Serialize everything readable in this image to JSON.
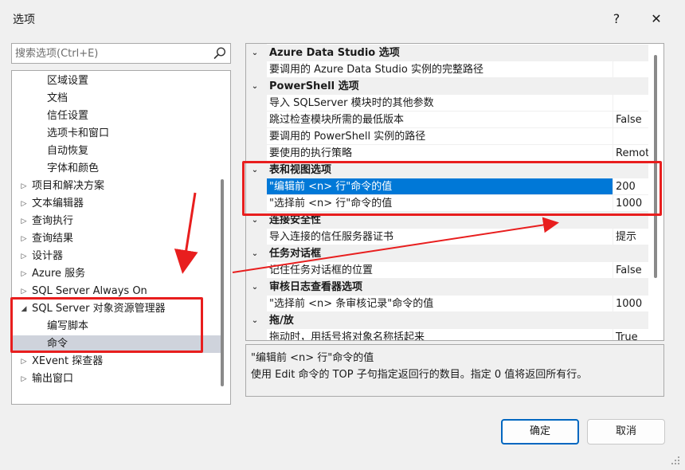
{
  "window": {
    "title": "选项",
    "help_glyph": "?",
    "close_glyph": "✕"
  },
  "search": {
    "placeholder": "搜索选项(Ctrl+E)"
  },
  "tree": [
    {
      "label": "区域设置",
      "level": 2
    },
    {
      "label": "文档",
      "level": 2
    },
    {
      "label": "信任设置",
      "level": 2
    },
    {
      "label": "选项卡和窗口",
      "level": 2
    },
    {
      "label": "自动恢复",
      "level": 2
    },
    {
      "label": "字体和颜色",
      "level": 2
    },
    {
      "label": "项目和解决方案",
      "level": 1,
      "expander": "▷"
    },
    {
      "label": "文本编辑器",
      "level": 1,
      "expander": "▷"
    },
    {
      "label": "查询执行",
      "level": 1,
      "expander": "▷"
    },
    {
      "label": "查询结果",
      "level": 1,
      "expander": "▷"
    },
    {
      "label": "设计器",
      "level": 1,
      "expander": "▷"
    },
    {
      "label": "Azure 服务",
      "level": 1,
      "expander": "▷"
    },
    {
      "label": "SQL Server Always On",
      "level": 1,
      "expander": "▷"
    },
    {
      "label": "SQL Server 对象资源管理器",
      "level": 1,
      "expander": "◢"
    },
    {
      "label": "编写脚本",
      "level": 2
    },
    {
      "label": "命令",
      "level": 2,
      "selected": true
    },
    {
      "label": "XEvent 探查器",
      "level": 1,
      "expander": "▷"
    },
    {
      "label": "输出窗口",
      "level": 1,
      "expander": "▷"
    }
  ],
  "grid": [
    {
      "type": "category",
      "label": "Azure Data Studio 选项",
      "arrow": "⌄"
    },
    {
      "type": "prop",
      "name": "要调用的 Azure Data Studio 实例的完整路径",
      "value": ""
    },
    {
      "type": "category",
      "label": "PowerShell 选项",
      "arrow": "⌄"
    },
    {
      "type": "prop",
      "name": "导入 SQLServer 模块时的其他参数",
      "value": ""
    },
    {
      "type": "prop",
      "name": "跳过检查模块所需的最低版本",
      "value": "False"
    },
    {
      "type": "prop",
      "name": "要调用的 PowerShell 实例的路径",
      "value": ""
    },
    {
      "type": "prop",
      "name": "要使用的执行策略",
      "value": "Remot"
    },
    {
      "type": "category",
      "label": "表和视图选项",
      "arrow": "⌄"
    },
    {
      "type": "prop",
      "name": "\"编辑前 <n> 行\"命令的值",
      "value": "200",
      "selected": true
    },
    {
      "type": "prop",
      "name": "\"选择前 <n> 行\"命令的值",
      "value": "1000"
    },
    {
      "type": "category",
      "label": "连接安全性",
      "arrow": "⌄"
    },
    {
      "type": "prop",
      "name": "导入连接的信任服务器证书",
      "value": "提示"
    },
    {
      "type": "category",
      "label": "任务对话框",
      "arrow": "⌄"
    },
    {
      "type": "prop",
      "name": "记住任务对话框的位置",
      "value": "False"
    },
    {
      "type": "category",
      "label": "审核日志查看器选项",
      "arrow": "⌄"
    },
    {
      "type": "prop",
      "name": "\"选择前 <n> 条审核记录\"命令的值",
      "value": "1000"
    },
    {
      "type": "category",
      "label": "拖/放",
      "arrow": "⌄"
    },
    {
      "type": "prop",
      "name": "拖动时，用括号将对象名称括起来",
      "value": "True"
    }
  ],
  "description": {
    "title": "\"编辑前 <n> 行\"命令的值",
    "text": "使用 Edit 命令的 TOP 子句指定返回行的数目。指定 0 值将返回所有行。"
  },
  "buttons": {
    "ok": "确定",
    "cancel": "取消"
  },
  "colors": {
    "accent": "#0078d7",
    "annotation": "#e81e1e",
    "selection_gray": "#cfd3dc"
  }
}
